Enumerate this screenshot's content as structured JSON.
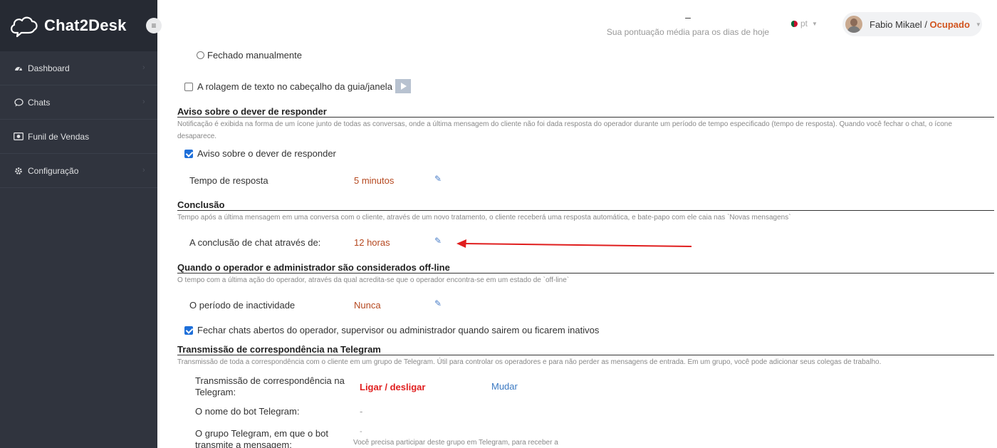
{
  "header": {
    "logo_text": "Chat2Desk",
    "menu_icon": "hamburger-icon",
    "score_value": "–",
    "score_caption": "Sua pontuação média para os dias de hoje",
    "lang": "pt",
    "user_name": "Fabio Mikael",
    "user_separator": " / ",
    "user_status": "Ocupado"
  },
  "sidebar": {
    "items": [
      {
        "label": "Dashboard",
        "icon": "dashboard-icon"
      },
      {
        "label": "Chats",
        "icon": "chat-icon"
      },
      {
        "label": "Funil de Vendas",
        "icon": "funnel-icon"
      },
      {
        "label": "Configuração",
        "icon": "gear-icon"
      }
    ]
  },
  "content": {
    "radio_closed_manually": "Fechado manualmente",
    "scroll_text_label": "A rolagem de texto no cabeçalho da guia/janela",
    "section_response": {
      "title": "Aviso sobre o dever de responder",
      "description": "Notificação é exibida na forma de um ícone junto de todas as conversas, onde a última mensagem do cliente não foi dada resposta do operador durante um período de tempo especificado (tempo de resposta). Quando você fechar o chat, o ícone desaparece.",
      "checkbox_label": "Aviso sobre o dever de responder",
      "row_label": "Tempo de resposta",
      "row_value": "5 minutos"
    },
    "section_conclusion": {
      "title": "Conclusão",
      "description": "Tempo após a última mensagem em uma conversa com o cliente, através de um novo tratamento, o cliente receberá uma resposta automática, e bate-papo com ele caia nas `Novas mensagens`",
      "row_label": "A conclusão de chat através de:",
      "row_value": "12 horas"
    },
    "section_offline": {
      "title": "Quando o operador e administrador são considerados off-line",
      "description": "O tempo com a última ação do operador, através da qual acredita-se que o operador encontra-se em um estado de `off-line`",
      "row_label": "O período de inactividade",
      "row_value": "Nunca",
      "checkbox_label": "Fechar chats abertos do operador, supervisor ou administrador quando sairem ou ficarem inativos"
    },
    "section_telegram": {
      "title": "Transmissão de correspondência na Telegram",
      "description": "Transmissão de toda a correspondência com o cliente em um grupo de Telegram. Útil para controlar os operadores e para não perder as mensagens de entrada. Em um grupo, você pode adicionar seus colegas de trabalho.",
      "row1_label_line1": "Transmissão de correspondência na",
      "row1_label_line2": "Telegram:",
      "row1_value": "Ligar / desligar",
      "row1_link": "Mudar",
      "row2_label": "O nome do bot Telegram:",
      "row2_value": "-",
      "row3_label_line1": "O grupo Telegram, em que o bot",
      "row3_label_line2": "transmite a mensagem:",
      "row3_value": "-",
      "row3_hint": "Você precisa participar deste grupo em Telegram, para receber a"
    }
  },
  "colors": {
    "sidebar_bg": "#30343e",
    "logo_bg": "#262a33",
    "status": "#d25520",
    "value": "#b5481f",
    "arrow": "#e01e1e"
  }
}
